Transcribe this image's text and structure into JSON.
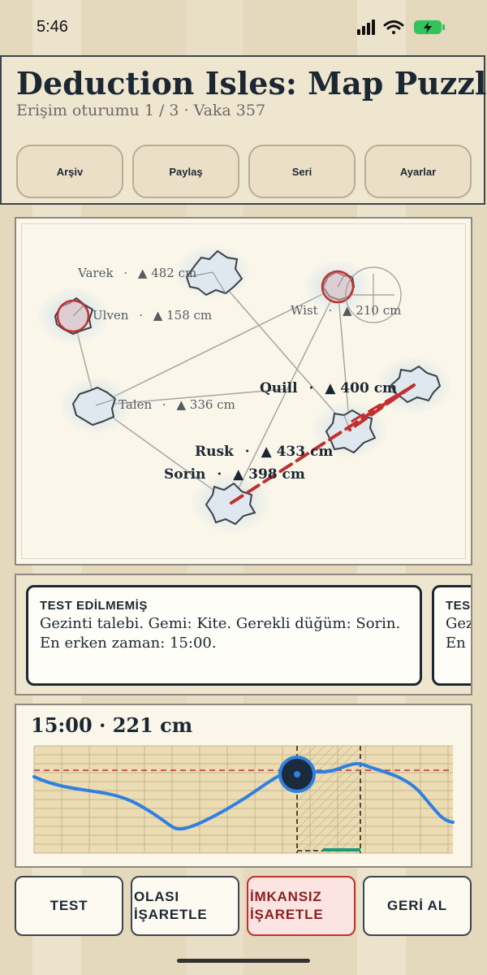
{
  "status_bar": {
    "time": "5:46"
  },
  "header": {
    "title": "Deduction Isles: Map Puzzle",
    "subtitle": "Erişim oturumu 1 / 3 · Vaka 357",
    "buttons": [
      "Arşiv",
      "Paylaş",
      "Seri",
      "Ayarlar"
    ]
  },
  "map": {
    "islands": [
      {
        "name": "Varek",
        "height": "▲ 482 cm",
        "marked_impossible": false
      },
      {
        "name": "Ulven",
        "height": "▲ 158 cm",
        "marked_impossible": true
      },
      {
        "name": "Wist",
        "height": "▲ 210 cm",
        "marked_impossible": true
      },
      {
        "name": "Talen",
        "height": "▲ 336 cm",
        "marked_impossible": false
      },
      {
        "name": "Quill",
        "height": "▲ 400 cm",
        "marked_impossible": false
      },
      {
        "name": "Rusk",
        "height": "▲ 433 cm",
        "marked_impossible": false
      },
      {
        "name": "Sorin",
        "height": "▲ 398 cm",
        "marked_impossible": false
      }
    ],
    "separator": "·",
    "route_color": "#c0302e",
    "impossible_color": "#c0302e"
  },
  "clues": [
    {
      "tag": "TEST EDİLMEMİŞ",
      "text": "Gezinti talebi. Gemi: Kite. Gerekli düğüm: Sorin.\nEn erken zaman: 15:00."
    },
    {
      "tag": "TES",
      "text": "Gez\nEn e"
    }
  ],
  "tide": {
    "readout": "15:00  ·  221 cm",
    "accent": "#2f80e0"
  },
  "actions": [
    {
      "label": "TEST",
      "style": "normal"
    },
    {
      "label": "OLASI\nİŞARETLE",
      "style": "normal"
    },
    {
      "label": "İMKANSIZ\nİŞARETLE",
      "style": "danger"
    },
    {
      "label": "GERİ AL",
      "style": "normal"
    }
  ]
}
